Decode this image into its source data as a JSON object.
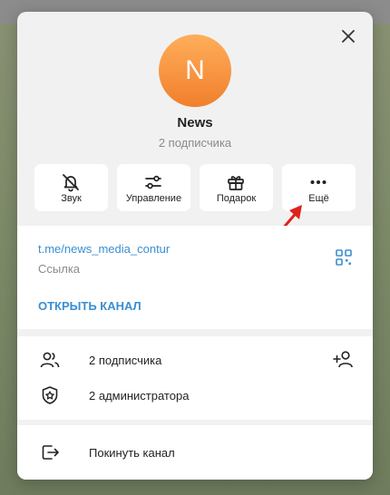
{
  "channel": {
    "avatar_letter": "N",
    "name": "News",
    "subscribers": "2 подписчика"
  },
  "actions": [
    {
      "label": "Звук",
      "icon": "bell-off-icon"
    },
    {
      "label": "Управление",
      "icon": "sliders-icon"
    },
    {
      "label": "Подарок",
      "icon": "gift-icon"
    },
    {
      "label": "Ещё",
      "icon": "more-dots-icon"
    }
  ],
  "info": {
    "link": "t.me/news_media_contur",
    "link_label": "Ссылка",
    "open_channel": "ОТКРЫТЬ КАНАЛ"
  },
  "members": {
    "subscribers": "2 подписчика",
    "admins": "2 администратора"
  },
  "leave": "Покинуть канал",
  "colors": {
    "accent": "#3a8ed1",
    "avatar_top": "#ffae5a",
    "avatar_bottom": "#f17f2c",
    "annotation_arrow": "#e0221c"
  }
}
